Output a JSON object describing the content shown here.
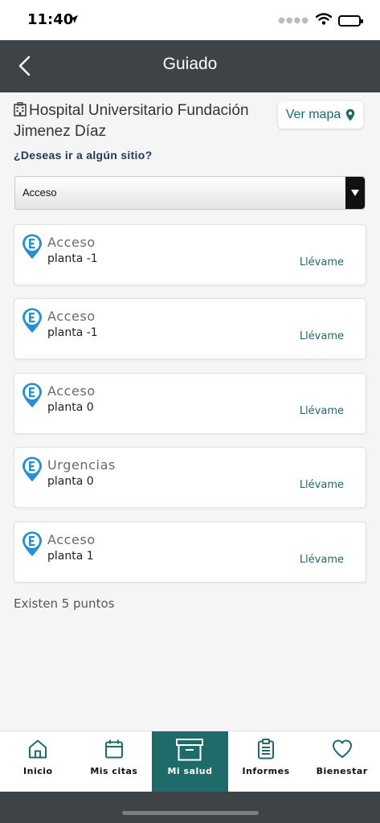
{
  "status_bar": {
    "time": "11:40"
  },
  "nav": {
    "title": "Guiado"
  },
  "hospital": {
    "name": "Hospital Universitario Fundación Jimenez Díaz"
  },
  "map_button": {
    "label": "Ver mapa"
  },
  "question": "¿Deseas ir a algún sitio?",
  "select": {
    "value": "Acceso"
  },
  "points": [
    {
      "title": "Acceso",
      "floor": "planta -1",
      "action": "Llévame"
    },
    {
      "title": "Acceso",
      "floor": "planta -1",
      "action": "Llévame"
    },
    {
      "title": "Acceso",
      "floor": "planta 0",
      "action": "Llévame"
    },
    {
      "title": "Urgencias",
      "floor": "planta 0",
      "action": "Llévame"
    },
    {
      "title": "Acceso",
      "floor": "planta 1",
      "action": "Llévame"
    }
  ],
  "count_text": "Existen 5 puntos",
  "tabs": [
    {
      "label": "Inicio",
      "icon": "home-icon"
    },
    {
      "label": "Mis citas",
      "icon": "calendar-icon"
    },
    {
      "label": "Mi salud",
      "icon": "archive-box-icon"
    },
    {
      "label": "Informes",
      "icon": "clipboard-icon"
    },
    {
      "label": "Bienestar",
      "icon": "heart-icon"
    }
  ],
  "colors": {
    "accent": "#1e6b6a",
    "header": "#3d4347",
    "pin": "#2a8fd0",
    "heading": "#22385a"
  }
}
